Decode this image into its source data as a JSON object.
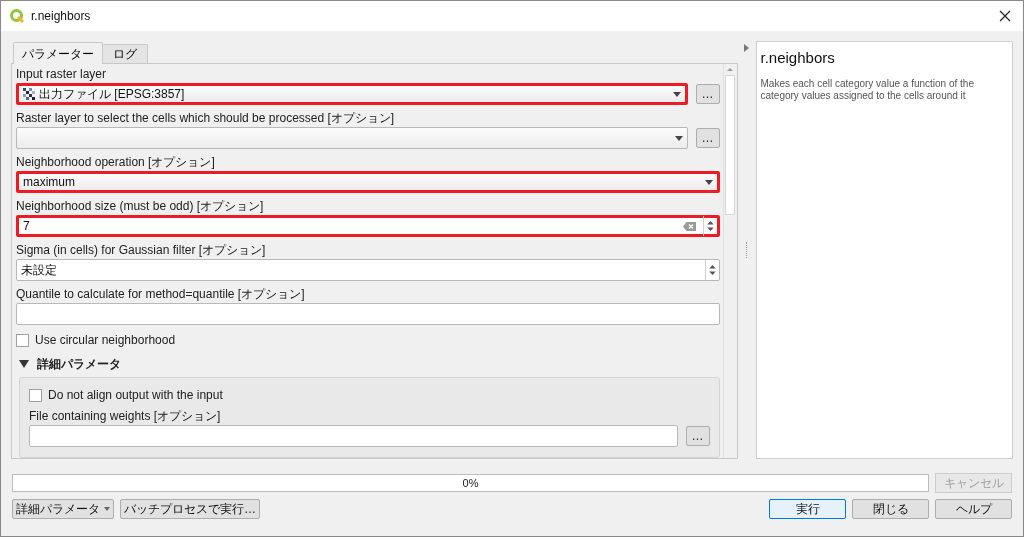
{
  "window": {
    "title": "r.neighbors"
  },
  "tabs": [
    {
      "label": "パラメーター",
      "selected": true
    },
    {
      "label": "ログ",
      "selected": false
    }
  ],
  "parameters": [
    {
      "kind": "combo",
      "label": "Input raster layer",
      "value": "出力ファイル [EPSG:3857]",
      "layer_icon": true,
      "highlighted": true,
      "button_text": "…"
    },
    {
      "kind": "combo",
      "label": "Raster layer to select the cells which should be processed [オプション]",
      "layer_icon": false,
      "highlighted": false,
      "button_text": "…"
    },
    {
      "kind": "combo",
      "label": "Neighborhood operation [オプション]",
      "value": "maximum",
      "layer_icon": false,
      "highlighted": true
    },
    {
      "kind": "spin",
      "label": "Neighborhood size (must be odd) [オプション]",
      "value": "7",
      "clear_button": true,
      "highlighted": true
    },
    {
      "kind": "spin",
      "label": "Sigma (in cells) for Gaussian filter [オプション]",
      "value": "未設定",
      "clear_button": false,
      "highlighted": false
    },
    {
      "kind": "text",
      "label": "Quantile to calculate for method=quantile [オプション]",
      "highlighted": false
    },
    {
      "kind": "checkbox",
      "label": "Use circular neighborhood",
      "checked": false
    },
    {
      "kind": "group",
      "label": "詳細パラメータ",
      "expanded": true,
      "children": [
        {
          "kind": "checkbox",
          "label": "Do not align output with the input",
          "checked": false
        },
        {
          "kind": "text",
          "label": "File containing weights [オプション]",
          "highlighted": false,
          "button_text": "…"
        }
      ]
    }
  ],
  "help": {
    "title": "r.neighbors",
    "description": "Makes each cell category value a function of the category values assigned to the cells around it"
  },
  "progress": {
    "level": 0,
    "text": "0%"
  },
  "cancel_button": {
    "label": "キャンセル",
    "disabled": true
  },
  "left_buttons": [
    {
      "label": "詳細パラメータ",
      "dropdown": true
    },
    {
      "label": "バッチプロセスで実行…",
      "dropdown": false
    }
  ],
  "right_buttons": [
    {
      "label": "実行",
      "default": true
    },
    {
      "label": "閉じる",
      "default": false
    },
    {
      "label": "ヘルプ",
      "default": false
    }
  ]
}
